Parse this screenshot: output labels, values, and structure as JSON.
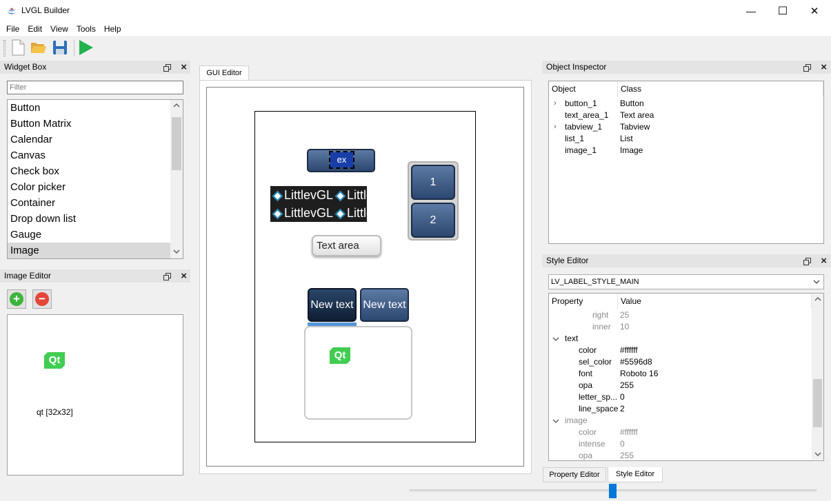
{
  "window": {
    "title": "LVGL Builder",
    "min_glyph": "—",
    "max_glyph": "☐",
    "close_glyph": "✕"
  },
  "menu": [
    "File",
    "Edit",
    "View",
    "Tools",
    "Help"
  ],
  "toolbar": {
    "buttons": [
      {
        "icon": "new-file-icon"
      },
      {
        "icon": "open-folder-icon"
      },
      {
        "icon": "save-icon"
      },
      {
        "icon": "run-icon"
      }
    ],
    "colors": {
      "run": "#22b14c",
      "folder": "#f5c24a",
      "save": "#2d6fb8"
    }
  },
  "widget_box": {
    "title": "Widget Box",
    "filter_placeholder": "Filter",
    "items": [
      "Button",
      "Button Matrix",
      "Calendar",
      "Canvas",
      "Check box",
      "Color picker",
      "Container",
      "Drop down list",
      "Gauge",
      "Image"
    ],
    "selected": "Image"
  },
  "image_editor": {
    "title": "Image Editor",
    "add_glyph": "+",
    "remove_glyph": "−",
    "image_logo": "Qt",
    "image_caption": "qt [32x32]",
    "colors": {
      "add": "#3cb43c",
      "remove": "#e5463a",
      "qt_green": "#41cd52"
    }
  },
  "gui_editor": {
    "tab": "GUI Editor",
    "button_label": "ex",
    "image_text": "LittlevGL",
    "textarea_text": "Text area",
    "list_items": [
      "1",
      "2"
    ],
    "tabs": [
      "New text",
      "New text"
    ],
    "tab_logo": "Qt",
    "colors": {
      "indicator": "#5596d8"
    }
  },
  "object_inspector": {
    "title": "Object Inspector",
    "columns": [
      "Object",
      "Class"
    ],
    "rows": [
      {
        "object": "button_1",
        "class": "Button",
        "expandable": true
      },
      {
        "object": "text_area_1",
        "class": "Text area",
        "expandable": false
      },
      {
        "object": "tabview_1",
        "class": "Tabview",
        "expandable": true
      },
      {
        "object": "list_1",
        "class": "List",
        "expandable": false
      },
      {
        "object": "image_1",
        "class": "Image",
        "expandable": false
      }
    ]
  },
  "style_editor": {
    "title": "Style Editor",
    "style_select": "LV_LABEL_STYLE_MAIN",
    "columns": [
      "Property",
      "Value"
    ],
    "rows": [
      {
        "property": "right",
        "value": "25",
        "level": 2,
        "dim": true
      },
      {
        "property": "inner",
        "value": "10",
        "level": 2,
        "dim": true
      },
      {
        "property": "text",
        "value": "",
        "level": 0,
        "expanded": true
      },
      {
        "property": "color",
        "value": "#ffffff",
        "level": 1
      },
      {
        "property": "sel_color",
        "value": "#5596d8",
        "level": 1
      },
      {
        "property": "font",
        "value": "Roboto 16",
        "level": 1
      },
      {
        "property": "opa",
        "value": "255",
        "level": 1
      },
      {
        "property": "letter_sp...",
        "value": "0",
        "level": 1
      },
      {
        "property": "line_space",
        "value": "2",
        "level": 1
      },
      {
        "property": "image",
        "value": "",
        "level": 0,
        "expanded": true,
        "dim": true
      },
      {
        "property": "color",
        "value": "#ffffff",
        "level": 1,
        "dim": true
      },
      {
        "property": "intense",
        "value": "0",
        "level": 1,
        "dim": true
      },
      {
        "property": "opa",
        "value": "255",
        "level": 1,
        "dim": true
      }
    ]
  },
  "bottom_tabs": [
    "Property Editor",
    "Style Editor"
  ],
  "active_bottom_tab": "Style Editor"
}
